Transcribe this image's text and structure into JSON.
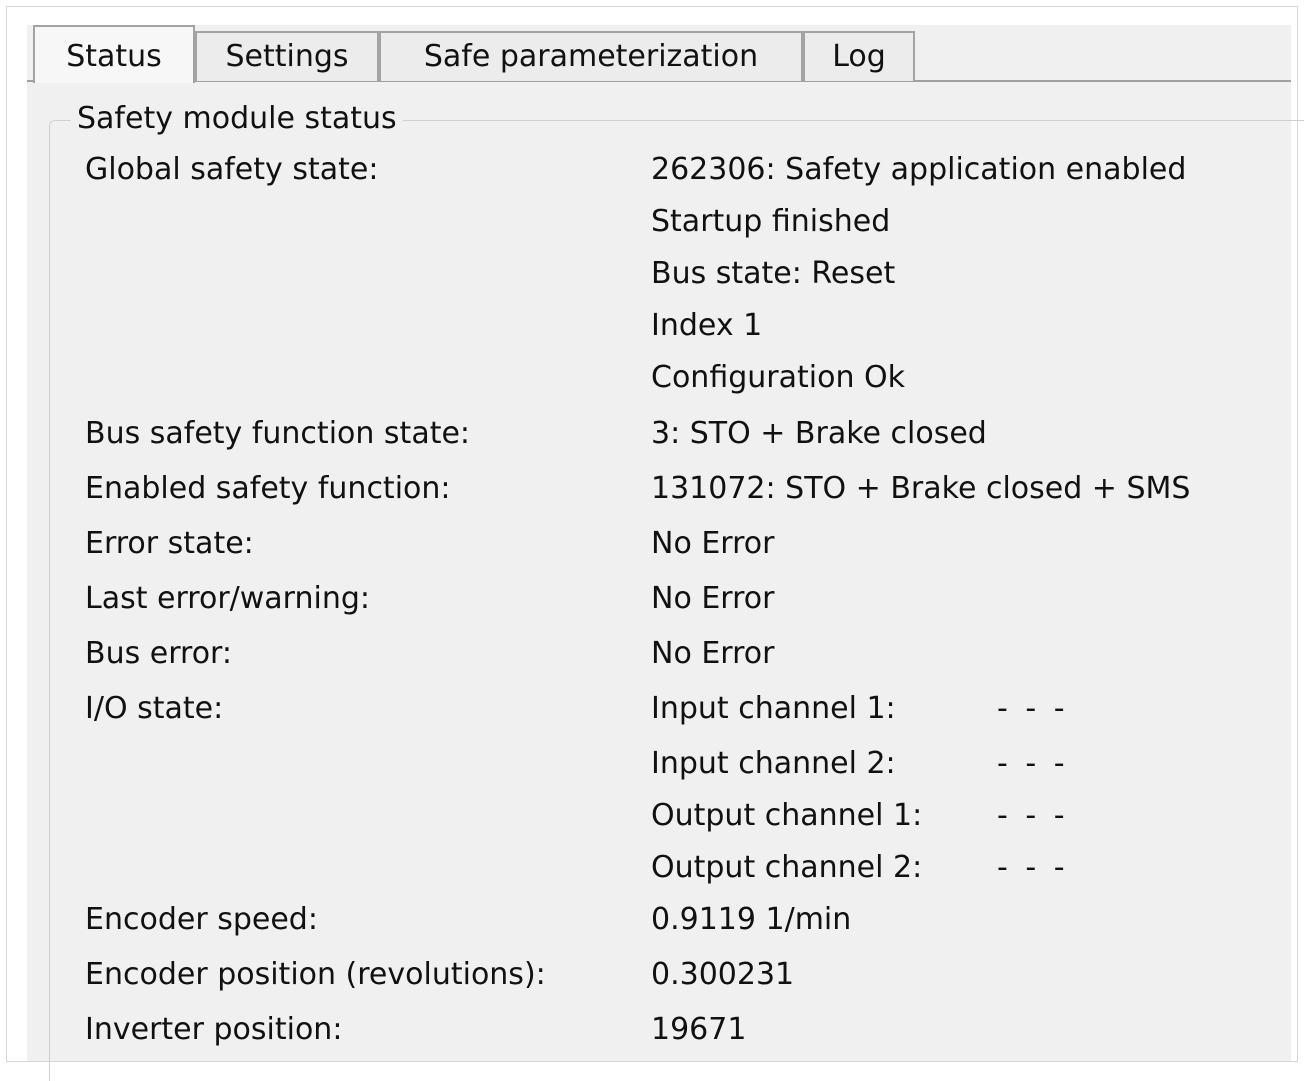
{
  "tabs": [
    {
      "label": "Status",
      "active": true
    },
    {
      "label": "Settings",
      "active": false
    },
    {
      "label": "Safe parameterization",
      "active": false
    },
    {
      "label": "Log",
      "active": false
    }
  ],
  "group": {
    "title": "Safety module status",
    "global_state": {
      "label": "Global safety state:",
      "values": [
        "262306: Safety application enabled",
        "Startup finished",
        "Bus state: Reset",
        "Index 1",
        "Configuration Ok"
      ]
    },
    "bus_safety_function_state": {
      "label": "Bus safety function state:",
      "value": "3: STO + Brake closed"
    },
    "enabled_safety_function": {
      "label": "Enabled safety function:",
      "value": "131072: STO + Brake closed + SMS"
    },
    "error_state": {
      "label": "Error state:",
      "value": "No Error"
    },
    "last_error": {
      "label": "Last error/warning:",
      "value": "No Error"
    },
    "bus_error": {
      "label": "Bus error:",
      "value": "No Error"
    },
    "io_state": {
      "label": "I/O state:",
      "channels": [
        {
          "name": "Input channel 1:",
          "value": "- - -"
        },
        {
          "name": "Input channel 2:",
          "value": "- - -"
        },
        {
          "name": "Output channel 1:",
          "value": "- - -"
        },
        {
          "name": "Output channel 2:",
          "value": "- - -"
        }
      ]
    },
    "encoder_speed": {
      "label": "Encoder speed:",
      "value": "0.9119 1/min"
    },
    "encoder_position": {
      "label": "Encoder position (revolutions):",
      "value": "0.300231"
    },
    "inverter_position": {
      "label": "Inverter position:",
      "value": "19671"
    }
  }
}
